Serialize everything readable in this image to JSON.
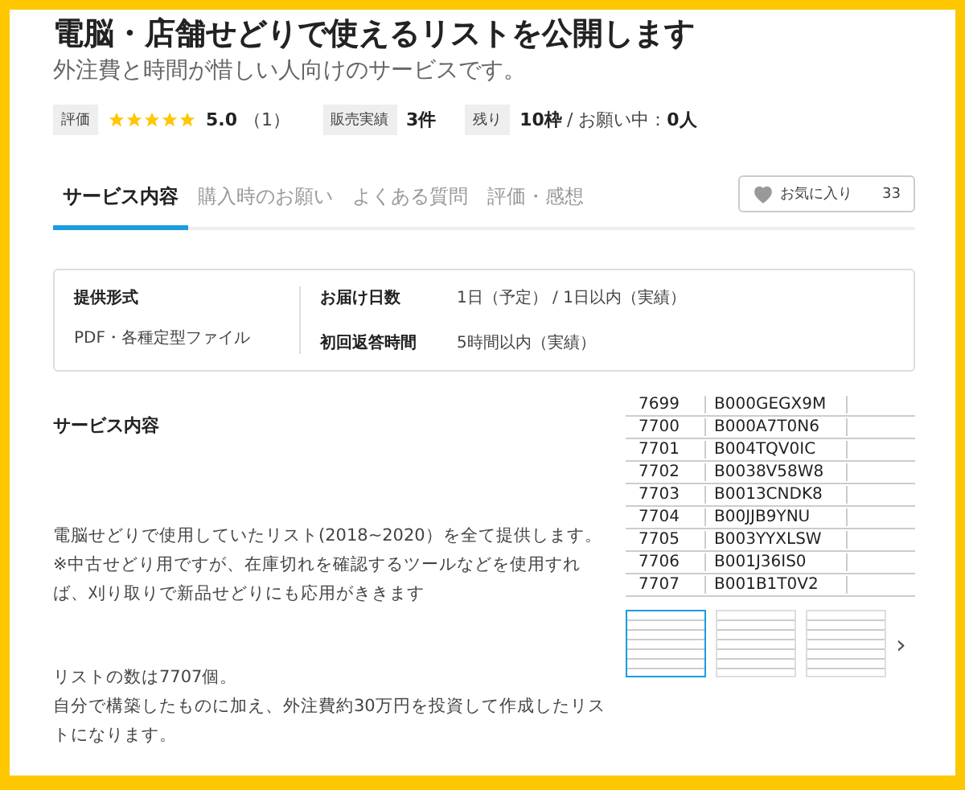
{
  "title": "電脳・店舗せどりで使えるリストを公開します",
  "subtitle": "外注費と時間が惜しい人向けのサービスです。",
  "meta": {
    "rating_label": "評価",
    "stars": 5,
    "score": "5.0",
    "review_count": "（1）",
    "sales_label": "販売実績",
    "sales": "3件",
    "remaining_label": "残り",
    "remaining": "10枠",
    "remaining_sep": "/ お願い中：",
    "waiting": "0人"
  },
  "tabs": [
    {
      "label": "サービス内容",
      "selected": true
    },
    {
      "label": "購入時のお願い",
      "selected": false
    },
    {
      "label": "よくある質問",
      "selected": false
    },
    {
      "label": "評価・感想",
      "selected": false
    }
  ],
  "favorite": {
    "label": "お気に入り",
    "count": "33"
  },
  "info": {
    "format_label": "提供形式",
    "format": "PDF・各種定型ファイル",
    "rows": [
      {
        "label": "お届け日数",
        "value": "1日（予定） / 1日以内（実績）"
      },
      {
        "label": "初回返答時間",
        "value": "5時間以内（実績）"
      }
    ]
  },
  "section_title": "サービス内容",
  "paragraphs": [
    [
      "電脳せどりで使用していたリスト(2018~2020）を全て提供します。",
      "※中古せどり用ですが、在庫切れを確認するツールなどを使用すれば、刈り取りで新品せどりにも応用がききます"
    ],
    [
      "リストの数は7707個。",
      "自分で構築したものに加え、外注費約30万円を投資して作成したリストになります。"
    ]
  ],
  "gallery": {
    "rows": [
      [
        "7699",
        "B000GEGX9M"
      ],
      [
        "7700",
        "B000A7T0N6"
      ],
      [
        "7701",
        "B004TQV0IC"
      ],
      [
        "7702",
        "B0038V58W8"
      ],
      [
        "7703",
        "B0013CNDK8"
      ],
      [
        "7704",
        "B00JJB9YNU"
      ],
      [
        "7705",
        "B003YYXLSW"
      ],
      [
        "7706",
        "B001J36IS0"
      ],
      [
        "7707",
        "B001B1T0V2"
      ]
    ],
    "thumbnails": [
      {
        "selected": true
      },
      {
        "selected": false
      },
      {
        "selected": false
      }
    ],
    "next": "›"
  }
}
